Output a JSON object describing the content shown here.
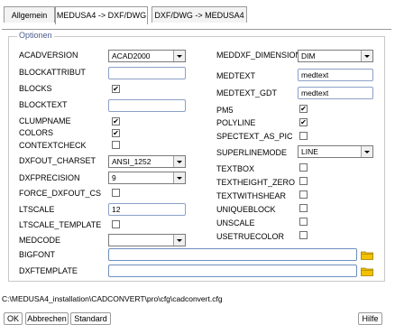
{
  "tabs": [
    "Allgemein",
    "MEDUSA4 -> DXF/DWG",
    "DXF/DWG -> MEDUSA4"
  ],
  "group_title": "Optionen",
  "left": {
    "acadversion": {
      "label": "ACADVERSION",
      "value": "ACAD2000"
    },
    "blockattribut": {
      "label": "BLOCKATTRIBUT",
      "value": ""
    },
    "blocks": {
      "label": "BLOCKS",
      "checked": true
    },
    "blocktext": {
      "label": "BLOCKTEXT",
      "value": ""
    },
    "clumpname": {
      "label": "CLUMPNAME",
      "checked": true
    },
    "colors": {
      "label": "COLORS",
      "checked": true
    },
    "contextcheck": {
      "label": "CONTEXTCHECK",
      "checked": false
    },
    "dxfout_charset": {
      "label": "DXFOUT_CHARSET",
      "value": "ANSI_1252"
    },
    "dxfprecision": {
      "label": "DXFPRECISION",
      "value": "9"
    },
    "force_dxfout_cs": {
      "label": "FORCE_DXFOUT_CS",
      "checked": false
    },
    "ltscale": {
      "label": "LTSCALE",
      "value": "12"
    },
    "ltscale_template": {
      "label": "LTSCALE_TEMPLATE",
      "checked": false
    },
    "medcode": {
      "label": "MEDCODE",
      "value": ""
    }
  },
  "right": {
    "meddxf_dimension": {
      "label": "MEDDXF_DIMENSION",
      "value": "DIM"
    },
    "medtext": {
      "label": "MEDTEXT",
      "value": "medtext"
    },
    "medtext_gdt": {
      "label": "MEDTEXT_GDT",
      "value": "medtext"
    },
    "pm5": {
      "label": "PM5",
      "checked": true
    },
    "polyline": {
      "label": "POLYLINE",
      "checked": true
    },
    "spectext_as_pic": {
      "label": "SPECTEXT_AS_PIC",
      "checked": false
    },
    "superlinemode": {
      "label": "SUPERLINEMODE",
      "value": "LINE"
    },
    "textbox": {
      "label": "TEXTBOX",
      "checked": false
    },
    "textheight_zero": {
      "label": "TEXTHEIGHT_ZERO",
      "checked": false
    },
    "textwithshear": {
      "label": "TEXTWITHSHEAR",
      "checked": false
    },
    "uniqueblock": {
      "label": "UNIQUEBLOCK",
      "checked": false
    },
    "unscale": {
      "label": "UNSCALE",
      "checked": false
    },
    "usetruecolor": {
      "label": "USETRUECOLOR",
      "checked": false
    }
  },
  "bigfont": {
    "label": "BIGFONT",
    "value": ""
  },
  "dxftemplate": {
    "label": "DXFTEMPLATE",
    "value": ""
  },
  "config_path": "C:\\MEDUSA4_installation\\CADCONVERT\\pro\\cfg\\cadconvert.cfg",
  "buttons": {
    "ok": "OK",
    "cancel": "Abbrechen",
    "standard": "Standard",
    "help": "Hilfe"
  },
  "check_glyph": "✔",
  "icons": {
    "dropdown": "chevron-down-icon",
    "folder": "folder-icon",
    "check": "check-icon"
  },
  "colors": {
    "field_border": "#8ca0c8",
    "group_title": "#4a5c8c",
    "folder": "#f2c200"
  }
}
